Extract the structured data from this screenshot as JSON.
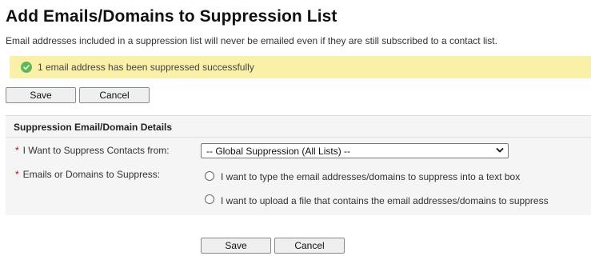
{
  "page": {
    "title": "Add Emails/Domains to Suppression List",
    "subtitle": "Email addresses included in a suppression list will never be emailed even if they are still subscribed to a contact list."
  },
  "notice": {
    "message": "1 email address has been suppressed successfully",
    "color": "#fbf0a8",
    "icon": "check-circle-icon"
  },
  "top_buttons": {
    "save": "Save",
    "cancel": "Cancel"
  },
  "panel": {
    "heading": "Suppression Email/Domain Details",
    "suppress_from": {
      "required_mark": "*",
      "label": "I Want to Suppress Contacts from:",
      "selected": "-- Global Suppression (All Lists) --"
    },
    "emails_or_domains": {
      "required_mark": "*",
      "label": "Emails or Domains to Suppress:",
      "options": [
        {
          "label": "I want to type the email addresses/domains to suppress into a text box",
          "selected": false
        },
        {
          "label": "I want to upload a file that contains the email addresses/domains to suppress",
          "selected": false
        }
      ]
    }
  },
  "bottom_buttons": {
    "save": "Save",
    "cancel": "Cancel"
  }
}
